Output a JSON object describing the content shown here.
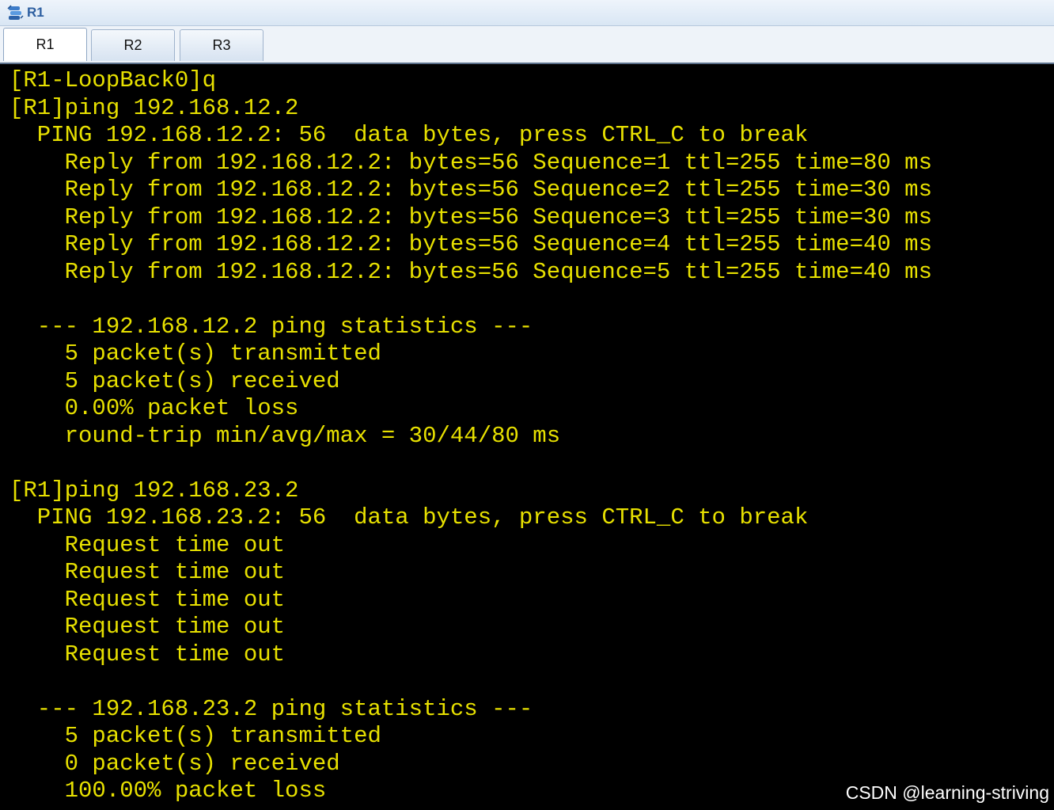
{
  "window": {
    "title": "R1",
    "icon": "router-console-icon"
  },
  "tabs": [
    {
      "label": "R1",
      "active": true
    },
    {
      "label": "R2",
      "active": false
    },
    {
      "label": "R3",
      "active": false
    }
  ],
  "terminal": {
    "text_color": "#e7e000",
    "background": "#000000",
    "lines": [
      "[R1-LoopBack0]q",
      "[R1]ping 192.168.12.2",
      "  PING 192.168.12.2: 56  data bytes, press CTRL_C to break",
      "    Reply from 192.168.12.2: bytes=56 Sequence=1 ttl=255 time=80 ms",
      "    Reply from 192.168.12.2: bytes=56 Sequence=2 ttl=255 time=30 ms",
      "    Reply from 192.168.12.2: bytes=56 Sequence=3 ttl=255 time=30 ms",
      "    Reply from 192.168.12.2: bytes=56 Sequence=4 ttl=255 time=40 ms",
      "    Reply from 192.168.12.2: bytes=56 Sequence=5 ttl=255 time=40 ms",
      "",
      "  --- 192.168.12.2 ping statistics ---",
      "    5 packet(s) transmitted",
      "    5 packet(s) received",
      "    0.00% packet loss",
      "    round-trip min/avg/max = 30/44/80 ms",
      "",
      "[R1]ping 192.168.23.2",
      "  PING 192.168.23.2: 56  data bytes, press CTRL_C to break",
      "    Request time out",
      "    Request time out",
      "    Request time out",
      "    Request time out",
      "    Request time out",
      "",
      "  --- 192.168.23.2 ping statistics ---",
      "    5 packet(s) transmitted",
      "    0 packet(s) received",
      "    100.00% packet loss"
    ]
  },
  "watermark": "CSDN @learning-striving"
}
